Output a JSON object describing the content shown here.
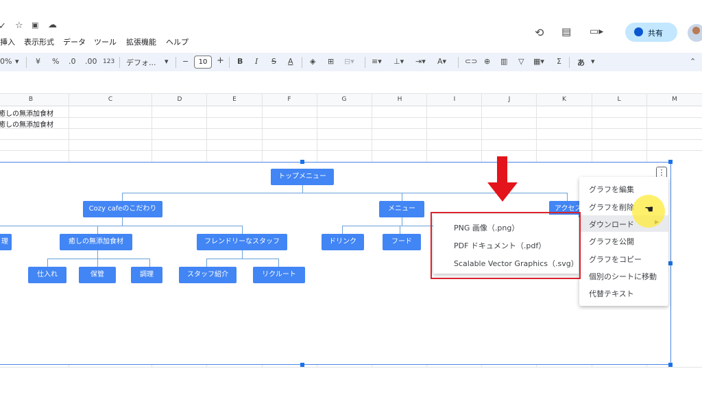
{
  "menu": {
    "items": [
      "挿入",
      "表示形式",
      "データ",
      "ツール",
      "拡張機能",
      "ヘルプ"
    ]
  },
  "header": {
    "share_label": "共有"
  },
  "toolbar": {
    "zoom": "0%",
    "currency": "¥",
    "percent": "%",
    "dec_dec": ".0",
    "dec_inc": ".00",
    "num_format": "123",
    "font": "デフォ...",
    "font_size": "10",
    "minus": "−",
    "plus": "+",
    "bold": "B",
    "italic": "I",
    "strike": "S",
    "textcolor": "A",
    "ime": "あ"
  },
  "grid": {
    "columns": [
      "B",
      "C",
      "D",
      "E",
      "F",
      "G",
      "H",
      "I",
      "J",
      "K",
      "L",
      "M"
    ],
    "cells": [
      "癒しの無添加食材",
      "癒しの無添加食材"
    ]
  },
  "chart": {
    "nodes": {
      "top": "トップメニュー",
      "cozy": "Cozy cafeのこだわり",
      "menu": "メニュー",
      "access": "アクセス",
      "iyashi": "癒しの無添加食材",
      "friendly": "フレンドリーなスタッフ",
      "drink": "ドリンク",
      "food": "フード",
      "shiire": "仕入れ",
      "hokan": "保管",
      "chori": "調理",
      "staff": "スタッフ紹介",
      "recruit": "リクルート",
      "left_edge": "理"
    }
  },
  "context_menu": {
    "items": [
      "グラフを編集",
      "グラフを削除",
      "ダウンロード",
      "グラフを公開",
      "グラフをコピー",
      "個別のシートに移動",
      "代替テキスト"
    ]
  },
  "download_submenu": {
    "items": [
      "PNG 画像（.png）",
      "PDF ドキュメント（.pdf）",
      "Scalable Vector Graphics（.svg）"
    ]
  },
  "colors": {
    "node": "#4285f4",
    "highlight_box": "#d9232d",
    "arrow": "#e3141b",
    "share": "#c2e7ff"
  }
}
